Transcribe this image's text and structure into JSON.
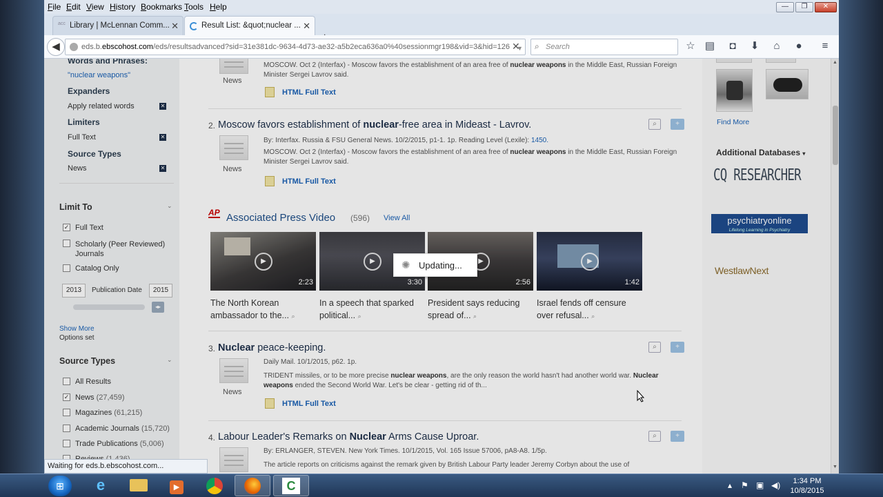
{
  "menubar": {
    "items": [
      "File",
      "Edit",
      "View",
      "History",
      "Bookmarks",
      "Tools",
      "Help"
    ],
    "underlined": [
      "F",
      "E",
      "V",
      "H",
      "B",
      "T",
      "H"
    ],
    "rest": [
      "ile",
      "dit",
      "iew",
      "istory",
      "ookmarks",
      "ools",
      "elp"
    ]
  },
  "window_controls": {
    "minimize": "—",
    "restore": "❐",
    "close": "✕"
  },
  "tabs": [
    {
      "label": "Library | McLennan Comm...",
      "active": false
    },
    {
      "label": "Result List: &quot;nuclear ...",
      "active": true
    }
  ],
  "newtab_label": "+",
  "url": {
    "host_prefix": "eds.b.",
    "host": "ebscohost.com",
    "path": "/eds/resultsadvanced?sid=31e381dc-9634-4d73-ae32-a5b2eca636a0%40sessionmgr198&vid=3&hid=126"
  },
  "search": {
    "placeholder": "Search"
  },
  "left_panel": {
    "words_heading": "Words and Phrases:",
    "words_value": "\"nuclear weapons\"",
    "expanders_heading": "Expanders",
    "expander_item": "Apply related words",
    "limiters_heading": "Limiters",
    "limiter_item": "Full Text",
    "source_types_heading": "Source Types",
    "source_item": "News",
    "remove_label": "✕",
    "limit_to_title": "Limit To",
    "limit_opts": [
      {
        "label": "Full Text",
        "checked": true
      },
      {
        "label": "Scholarly (Peer Reviewed) Journals",
        "checked": false
      },
      {
        "label": "Catalog Only",
        "checked": false
      }
    ],
    "date_from": "2013",
    "date_label": "Publication Date",
    "date_to": "2015",
    "show_more": "Show More",
    "options_set": "Options set",
    "source_types_title": "Source Types",
    "source_opts": [
      {
        "label": "All Results",
        "count": "",
        "checked": false
      },
      {
        "label": "News",
        "count": "(27,459)",
        "checked": true
      },
      {
        "label": "Magazines",
        "count": "(61,215)",
        "checked": false
      },
      {
        "label": "Academic Journals",
        "count": "(15,720)",
        "checked": false
      },
      {
        "label": "Trade Publications",
        "count": "(5,006)",
        "checked": false
      },
      {
        "label": "Reviews",
        "count": "(1,436)",
        "checked": false
      }
    ]
  },
  "results": {
    "r1": {
      "thumb_label": "News",
      "abstract_html": "MOSCOW. Oct 2 (Interfax) - Moscow favors the establishment of an area free of <b>nuclear weapons</b> in the Middle East, Russian Foreign Minister Sergei Lavrov said.",
      "fulltext": "HTML Full Text"
    },
    "r2": {
      "num": "2.",
      "title_html": "Moscow favors establishment of <strong>nuclear</strong>-free area in Mideast - Lavrov.",
      "meta": "By: Interfax. Russia & FSU General News. 10/2/2015, p1-1. 1p. Reading Level (Lexile):",
      "lexile": "1450.",
      "abstract_html": "MOSCOW. Oct 2 (Interfax) - Moscow favors the establishment of an area free of <b>nuclear weapons</b> in the Middle East, Russian Foreign Minister Sergei Lavrov said.",
      "thumb_label": "News",
      "fulltext": "HTML Full Text"
    },
    "r3": {
      "num": "3.",
      "title_html": "<strong>Nuclear</strong> peace-keeping.",
      "meta": "Daily Mail. 10/1/2015, p62. 1p.",
      "abstract_html": "TRIDENT missiles, or to be more precise <b>nuclear weapons</b>, are the only reason the world hasn't had another world war. <b>Nuclear weapons</b> ended the Second World War. Let's be clear - getting rid of th...",
      "thumb_label": "News",
      "fulltext": "HTML Full Text"
    },
    "r4": {
      "num": "4.",
      "title_html": "Labour Leader's Remarks on <strong>Nuclear</strong> Arms Cause Uproar.",
      "meta": "By: ERLANGER, STEVEN. New York Times. 10/1/2015, Vol. 165 Issue 57006, pA8-A8. 1/5p.",
      "abstract": "The article reports on criticisms against the remark given by British Labour Party leader Jeremy Corbyn about the use of"
    }
  },
  "ap": {
    "badge": "AP",
    "title": "Associated Press Video",
    "count": "(596)",
    "view_all": "View All",
    "videos": [
      {
        "duration": "2:23",
        "caption": "The North Korean ambassador to the..."
      },
      {
        "duration": "3:30",
        "caption": "In a speech that sparked political..."
      },
      {
        "duration": "2:56",
        "caption": "President says reducing spread of..."
      },
      {
        "duration": "1:42",
        "caption": "Israel fends off censure over refusal..."
      }
    ]
  },
  "right_panel": {
    "find_more": "Find More",
    "additional_db": "Additional Databases",
    "cq": "CQ RESEARCHER",
    "psy_main": "psychiatryonline",
    "psy_sub": "Lifelong Learning in Psychiatry",
    "westlaw": "WestlawNext"
  },
  "updating": "Updating...",
  "status_text": "Waiting for eds.b.ebscohost.com...",
  "clock": {
    "time": "1:34 PM",
    "date": "10/8/2015"
  },
  "colors": {
    "link": "#1b63b7",
    "title": "#1d2f4a",
    "ap_red": "#cc0000",
    "psy": "#1f4c8f"
  }
}
